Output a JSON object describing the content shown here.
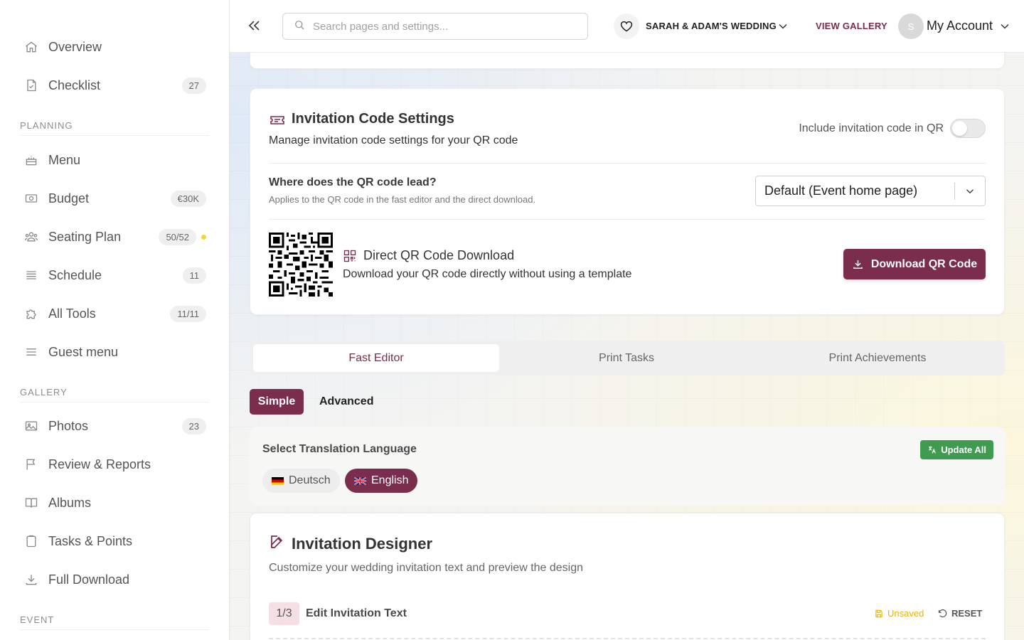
{
  "topbar": {
    "search_placeholder": "Search pages and settings...",
    "event_name": "SARAH & ADAM'S WEDDING",
    "view_gallery": "VIEW GALLERY",
    "avatar_initial": "S",
    "account_label": "My Account"
  },
  "sidebar": {
    "overview": {
      "label": "Overview",
      "icon": "home-icon"
    },
    "checklist": {
      "label": "Checklist",
      "badge": "27",
      "icon": "checklist-icon"
    },
    "planning_title": "PLANNING",
    "menu": {
      "label": "Menu",
      "icon": "cake-icon"
    },
    "budget": {
      "label": "Budget",
      "badge": "€30K",
      "icon": "money-icon"
    },
    "seating": {
      "label": "Seating Plan",
      "badge": "50/52",
      "icon": "people-icon",
      "dot_color": "#f5d634"
    },
    "schedule": {
      "label": "Schedule",
      "badge": "11",
      "icon": "list-icon"
    },
    "tools": {
      "label": "All Tools",
      "badge": "11/11",
      "icon": "puzzle-icon"
    },
    "guest_menu": {
      "label": "Guest menu",
      "icon": "hamburger-icon"
    },
    "gallery_title": "GALLERY",
    "photos": {
      "label": "Photos",
      "badge": "23",
      "icon": "image-icon"
    },
    "reviews": {
      "label": "Review & Reports",
      "icon": "flag-icon"
    },
    "albums": {
      "label": "Albums",
      "icon": "book-icon"
    },
    "tasks": {
      "label": "Tasks & Points",
      "icon": "clipboard-icon"
    },
    "download": {
      "label": "Full Download",
      "icon": "download-icon"
    },
    "event_title": "EVENT"
  },
  "invitation_code": {
    "title": "Invitation Code Settings",
    "subtitle": "Manage invitation code settings for your QR code",
    "toggle_label": "Include invitation code in QR",
    "toggle_on": false,
    "lead_title": "Where does the QR code lead?",
    "lead_subtitle": "Applies to the QR code in the fast editor and the direct download.",
    "lead_selected": "Default (Event home page)",
    "download_title": "Direct QR Code Download",
    "download_subtitle": "Download your QR code directly without using a template",
    "download_button": "Download QR Code"
  },
  "tabs": {
    "fast_editor": "Fast Editor",
    "print_tasks": "Print Tasks",
    "print_achievements": "Print Achievements",
    "active": "Fast Editor"
  },
  "mode": {
    "simple": "Simple",
    "advanced": "Advanced",
    "active": "Simple"
  },
  "translation": {
    "title": "Select Translation Language",
    "update_all": "Update All",
    "deutsch": "Deutsch",
    "english": "English",
    "selected": "English"
  },
  "designer": {
    "title": "Invitation Designer",
    "subtitle": "Customize your wedding invitation text and preview the design",
    "step": "1/3",
    "step_title": "Edit Invitation Text",
    "unsaved": "Unsaved",
    "reset": "RESET"
  },
  "colors": {
    "brand": "#7b2d4d",
    "success": "#3e9b4f",
    "warning": "#e9b400"
  }
}
